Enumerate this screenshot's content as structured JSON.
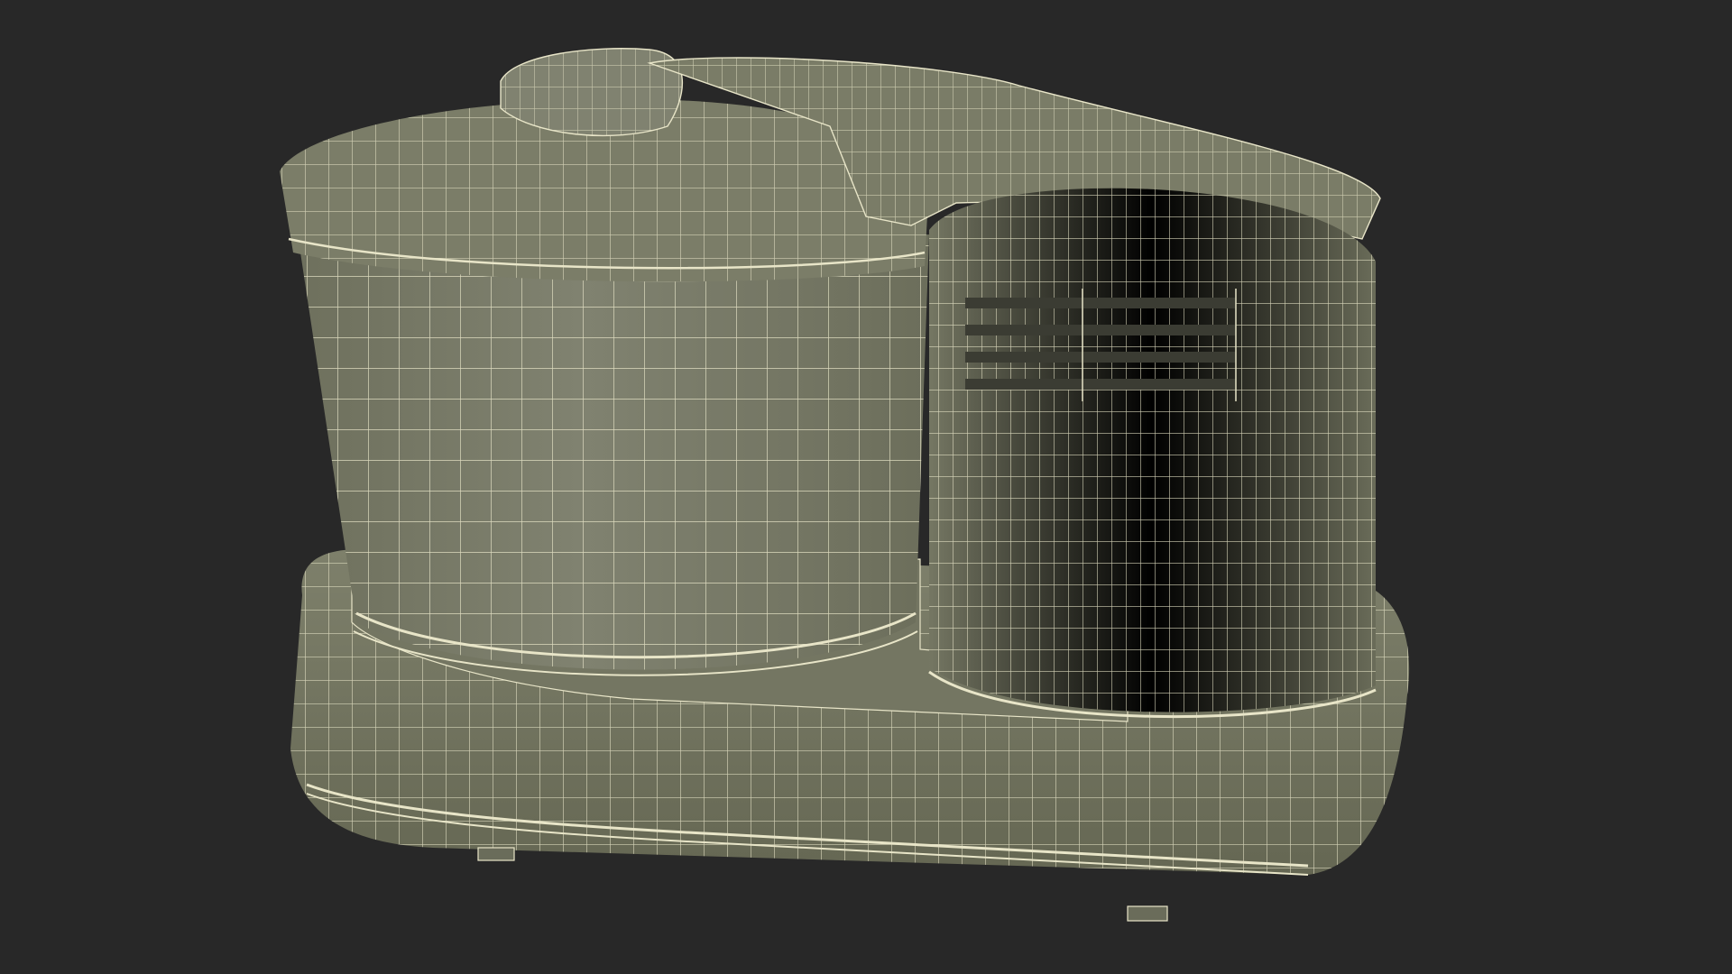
{
  "scene": {
    "subject": "wet-grinder-wireframe-render",
    "colors": {
      "background": "#282828",
      "body": "#7c7e69",
      "body_shadow": "#6a6c5a",
      "body_dark": "#5c5e4e",
      "wire": "#e8e5c8",
      "slot": "#3b3c33"
    }
  }
}
